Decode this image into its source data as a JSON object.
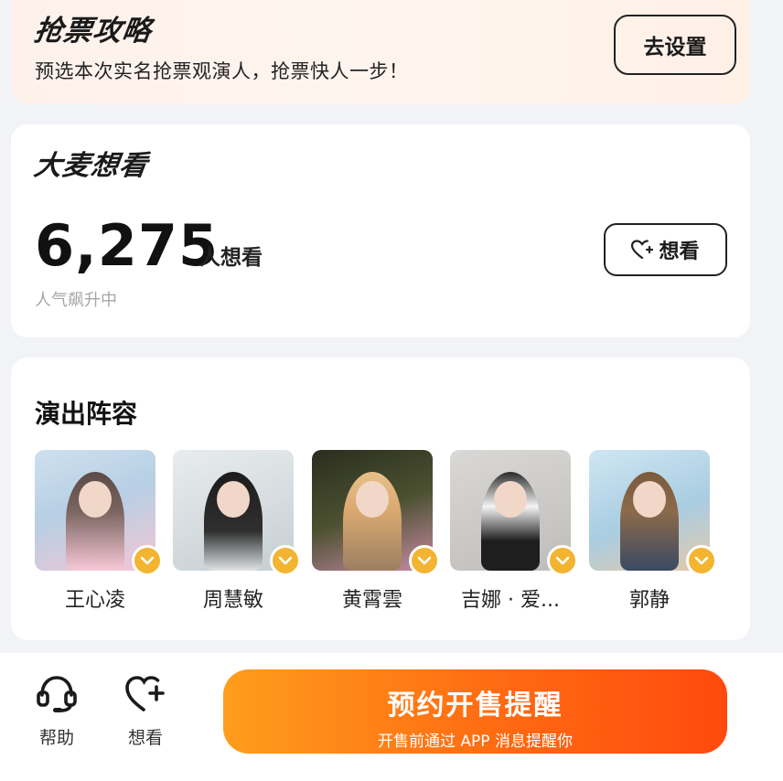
{
  "strategy": {
    "title": "抢票攻略",
    "subtitle": "预选本次实名抢票观演人，抢票快人一步！",
    "button_label": "去设置"
  },
  "want": {
    "title": "大麦想看",
    "count": "6,275",
    "count_suffix": "人想看",
    "status": "人气飙升中",
    "button_label": "想看"
  },
  "lineup": {
    "title": "演出阵容",
    "artists": [
      {
        "name": "王心凌"
      },
      {
        "name": "周慧敏"
      },
      {
        "name": "黄霄雲"
      },
      {
        "name": "吉娜 · 爱..."
      },
      {
        "name": "郭静"
      }
    ]
  },
  "bottom_bar": {
    "help_label": "帮助",
    "want_label": "想看",
    "reserve_label": "预约开售提醒",
    "reserve_sub": "开售前通过 APP 消息提醒你"
  },
  "colors": {
    "accent_orange": "#ff6a12",
    "badge_gold": "#f3b431",
    "heart_pink": "#ff4f9a"
  },
  "icons": [
    "headset-icon",
    "heart-plus-icon",
    "chevron-down-icon"
  ]
}
